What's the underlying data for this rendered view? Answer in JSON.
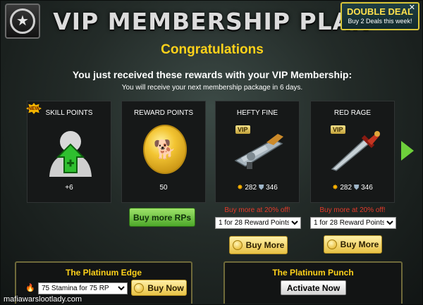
{
  "header": {
    "title": "VIP MEMBERSHIP PLAN",
    "badge_icon": "star-icon"
  },
  "double_deal": {
    "title": "DOUBLE DEAL",
    "subtitle": "Buy 2 Deals this week!",
    "close": "✕"
  },
  "congrats": "Congratulations",
  "headline": "You just received these rewards with your VIP Membership:",
  "subline": "You will receive your next membership package in 6 days.",
  "cards": [
    {
      "label": "SKILL POINTS",
      "value": "+6",
      "new": "NEW"
    },
    {
      "label": "REWARD POINTS",
      "value": "50"
    },
    {
      "label": "HEFTY FINE",
      "vip": "VIP",
      "attack": "282",
      "defense": "346"
    },
    {
      "label": "RED RAGE",
      "vip": "VIP",
      "attack": "282",
      "defense": "346"
    }
  ],
  "buy_more_rps": "Buy more RPs",
  "offers": [
    {
      "promo": "Buy more at 20% off!",
      "selected": "1 for 28 Reward Points",
      "button": "Buy More"
    },
    {
      "promo": "Buy more at 20% off!",
      "selected": "1 for 28 Reward Points",
      "button": "Buy More"
    }
  ],
  "platinum_edge": {
    "title": "The Platinum Edge",
    "selected": "75 Stamina for 75 RP",
    "button": "Buy Now"
  },
  "platinum_punch": {
    "title": "The Platinum Punch",
    "button": "Activate Now"
  },
  "watermark": "mafiawarslootlady.com",
  "colors": {
    "accent_gold": "#ffd21a",
    "promo_red": "#e33a2a",
    "next_arrow": "#6ed03b"
  }
}
